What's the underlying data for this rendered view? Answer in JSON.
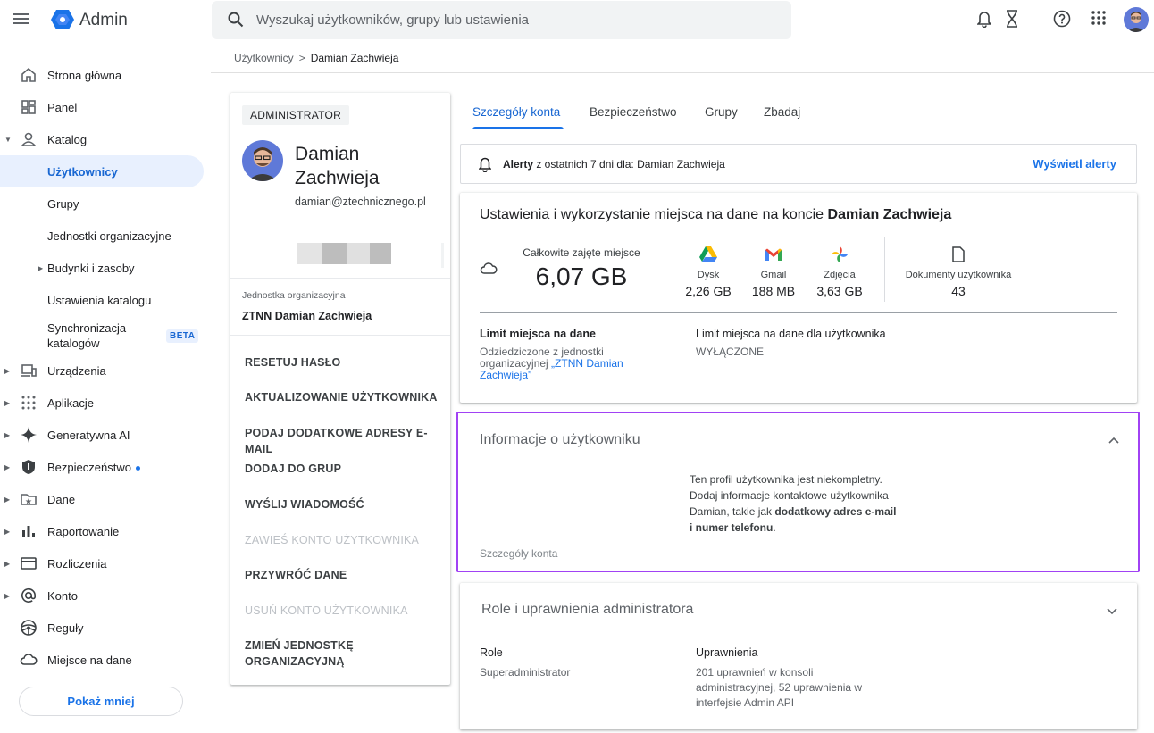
{
  "header": {
    "app_title": "Admin",
    "search_placeholder": "Wyszukaj użytkowników, grupy lub ustawienia"
  },
  "breadcrumb": {
    "parent": "Użytkownicy",
    "separator": ">",
    "current": "Damian Zachwieja"
  },
  "sidebar": {
    "items": [
      {
        "label": "Strona główna",
        "icon": "home-icon"
      },
      {
        "label": "Panel",
        "icon": "dashboard-icon"
      },
      {
        "label": "Katalog",
        "icon": "person-icon"
      },
      {
        "label": "Użytkownicy"
      },
      {
        "label": "Grupy"
      },
      {
        "label": "Jednostki organizacyjne"
      },
      {
        "label": "Budynki i zasoby"
      },
      {
        "label": "Ustawienia katalogu"
      },
      {
        "label": "Synchronizacja katalogów",
        "badge": "BETA"
      },
      {
        "label": "Urządzenia",
        "icon": "devices-icon"
      },
      {
        "label": "Aplikacje",
        "icon": "apps-grid-icon"
      },
      {
        "label": "Generatywna AI",
        "icon": "sparkle-icon"
      },
      {
        "label": "Bezpieczeństwo",
        "icon": "shield-icon"
      },
      {
        "label": "Dane",
        "icon": "folder-star-icon"
      },
      {
        "label": "Raportowanie",
        "icon": "bar-chart-icon"
      },
      {
        "label": "Rozliczenia",
        "icon": "credit-card-icon"
      },
      {
        "label": "Konto",
        "icon": "at-icon"
      },
      {
        "label": "Reguły",
        "icon": "steering-icon"
      },
      {
        "label": "Miejsce na dane",
        "icon": "cloud-icon"
      }
    ],
    "sync_line1": "Synchronizacja",
    "sync_line2": "katalogów",
    "show_less": "Pokaż mniej",
    "accent": "#1967d2"
  },
  "profile": {
    "role": "ADMINISTRATOR",
    "name_line1": "Damian",
    "name_line2": "Zachwieja",
    "email": "damian@ztechnicznego.pl",
    "org_label": "Jednostka organizacyjna",
    "org_value": "ZTNN Damian Zachwieja",
    "actions": [
      {
        "label": "RESETUJ HASŁO",
        "disabled": false
      },
      {
        "label": "AKTUALIZOWANIE UŻYTKOWNIKA",
        "disabled": false
      },
      {
        "label": "PODAJ DODATKOWE ADRESY E-MAIL",
        "disabled": false
      },
      {
        "label": "DODAJ DO GRUP",
        "disabled": false
      },
      {
        "label": "WYŚLIJ WIADOMOŚĆ",
        "disabled": false
      },
      {
        "label": "ZAWIEŚ KONTO UŻYTKOWNIKA",
        "disabled": true
      },
      {
        "label": "PRZYWRÓĆ DANE",
        "disabled": false
      },
      {
        "label": "USUŃ KONTO UŻYTKOWNIKA",
        "disabled": true
      },
      {
        "label": "ZMIEŃ JEDNOSTKĘ ORGANIZACYJNĄ",
        "disabled": false
      }
    ],
    "action_last_line1": "ZMIEŃ JEDNOSTKĘ",
    "action_last_line2": "ORGANIZACYJNĄ"
  },
  "tabs": [
    {
      "label": "Szczegóły konta",
      "active": true
    },
    {
      "label": "Bezpieczeństwo",
      "active": false
    },
    {
      "label": "Grupy",
      "active": false
    },
    {
      "label": "Zbadaj",
      "active": false
    }
  ],
  "alert": {
    "bold": "Alerty",
    "text": " z ostatnich 7 dni dla: Damian Zachwieja",
    "link": "Wyświetl alerty"
  },
  "storage": {
    "title_prefix": "Ustawienia i wykorzystanie miejsca na dane na koncie ",
    "title_name": "Damian Zachwieja",
    "total_label": "Całkowite zajęte miejsce",
    "total_value": "6,07 GB",
    "services": [
      {
        "name": "Dysk",
        "value": "2,26 GB",
        "icon": "drive-icon"
      },
      {
        "name": "Gmail",
        "value": "188 MB",
        "icon": "gmail-icon"
      },
      {
        "name": "Zdjęcia",
        "value": "3,63 GB",
        "icon": "photos-icon"
      }
    ],
    "docs_label": "Dokumenty użytkownika",
    "docs_value": "43",
    "limit_heading": "Limit miejsca na dane",
    "limit_line1": "Odziedziczone z jednostki",
    "limit_line2_prefix": "organizacyjnej ",
    "limit_link": "„ZTNN Damian Zachwieja”",
    "limit_link_line1": "„ZTNN Damian",
    "limit_link_line2": "Zachwieja”",
    "user_limit_heading": "Limit miejsca na dane dla użytkownika",
    "user_limit_value": "WYŁĄCZONE"
  },
  "user_info": {
    "title": "Informacje o użytkowniku",
    "line1": "Ten profil użytkownika jest niekompletny.",
    "line2": "Dodaj informacje kontaktowe użytkownika",
    "line3_prefix": "Damian, takie jak ",
    "line3_bold": "dodatkowy adres e-mail",
    "line4_bold": "i numer telefonu",
    "line4_suffix": ".",
    "footer": "Szczegóły konta",
    "highlight_color": "#a142f4"
  },
  "roles": {
    "title": "Role i uprawnienia administratora",
    "role_heading": "Role",
    "role_value": "Superadministrator",
    "perm_heading": "Uprawnienia",
    "perm_line1": "201 uprawnień w konsoli",
    "perm_line2": "administracyjnej, 52 uprawnienia w",
    "perm_line3": "interfejsie Admin API"
  }
}
